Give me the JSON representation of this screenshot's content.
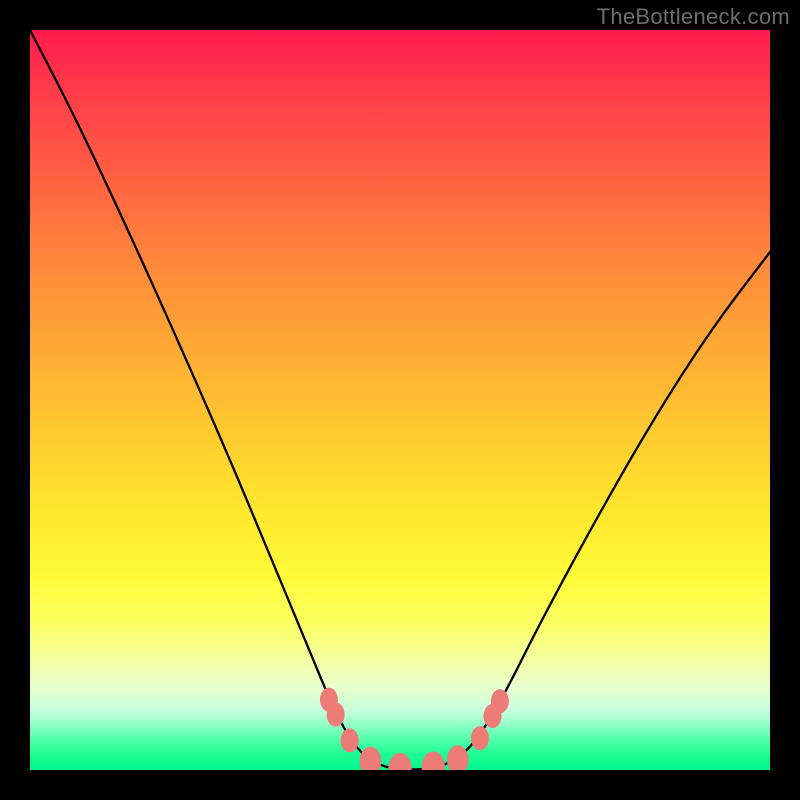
{
  "watermark": "TheBottleneck.com",
  "chart_data": {
    "type": "line",
    "title": "",
    "xlabel": "",
    "ylabel": "",
    "xlim": [
      0,
      1
    ],
    "ylim": [
      0,
      1
    ],
    "grid": false,
    "series": [
      {
        "name": "curve",
        "values": [
          {
            "x": 0.0,
            "y": 1.0
          },
          {
            "x": 0.062,
            "y": 0.88
          },
          {
            "x": 0.13,
            "y": 0.735
          },
          {
            "x": 0.2,
            "y": 0.58
          },
          {
            "x": 0.27,
            "y": 0.42
          },
          {
            "x": 0.32,
            "y": 0.3
          },
          {
            "x": 0.37,
            "y": 0.18
          },
          {
            "x": 0.405,
            "y": 0.095
          },
          {
            "x": 0.43,
            "y": 0.045
          },
          {
            "x": 0.455,
            "y": 0.015
          },
          {
            "x": 0.485,
            "y": 0.002
          },
          {
            "x": 0.52,
            "y": 0.0
          },
          {
            "x": 0.555,
            "y": 0.004
          },
          {
            "x": 0.585,
            "y": 0.02
          },
          {
            "x": 0.61,
            "y": 0.05
          },
          {
            "x": 0.64,
            "y": 0.1
          },
          {
            "x": 0.69,
            "y": 0.2
          },
          {
            "x": 0.76,
            "y": 0.33
          },
          {
            "x": 0.84,
            "y": 0.47
          },
          {
            "x": 0.92,
            "y": 0.595
          },
          {
            "x": 1.0,
            "y": 0.7
          }
        ]
      }
    ],
    "markers": [
      {
        "x": 0.404,
        "y": 0.095,
        "r": 1.0
      },
      {
        "x": 0.413,
        "y": 0.075,
        "r": 1.0
      },
      {
        "x": 0.432,
        "y": 0.04,
        "r": 1.0
      },
      {
        "x": 0.46,
        "y": 0.012,
        "r": 1.2
      },
      {
        "x": 0.5,
        "y": 0.002,
        "r": 1.3
      },
      {
        "x": 0.545,
        "y": 0.004,
        "r": 1.3
      },
      {
        "x": 0.578,
        "y": 0.014,
        "r": 1.2
      },
      {
        "x": 0.608,
        "y": 0.043,
        "r": 1.0
      },
      {
        "x": 0.625,
        "y": 0.073,
        "r": 1.0
      },
      {
        "x": 0.635,
        "y": 0.093,
        "r": 1.0
      }
    ],
    "colors": {
      "curve": "#000000",
      "markers": "#ed7b78",
      "gradient_top": "#ff1a4d",
      "gradient_mid": "#ffd52e",
      "gradient_bottom": "#00f790",
      "frame": "#000000"
    }
  }
}
